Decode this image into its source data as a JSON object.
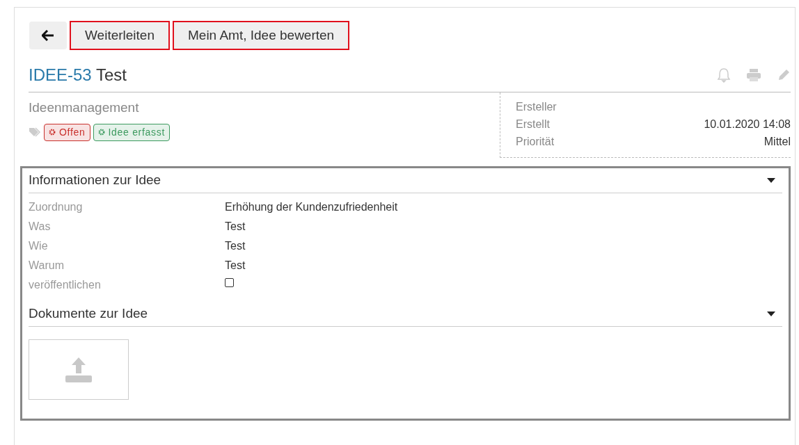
{
  "toolbar": {
    "buttons": [
      {
        "label": "Weiterleiten",
        "highlighted": true
      },
      {
        "label": "Mein Amt, Idee bewerten",
        "highlighted": true
      }
    ]
  },
  "title": {
    "key": "IDEE-53",
    "name": "Test"
  },
  "category": "Ideenmanagement",
  "tags": [
    {
      "label": "Offen",
      "color": "#c9302c"
    },
    {
      "label": "Idee erfasst",
      "color": "#3c9a5f"
    }
  ],
  "meta": [
    {
      "label": "Ersteller"
    },
    {
      "label": "Erstellt",
      "value": "10.01.2020 14:08"
    },
    {
      "label": "Priorität",
      "value": "Mittel"
    }
  ],
  "sections": [
    {
      "kind": "fields",
      "title": "Informationen zur Idee",
      "expanded": true,
      "fields": [
        {
          "kind": "text",
          "label": "Zuordnung",
          "value": "Erhöhung der Kundenzufriedenheit"
        },
        {
          "kind": "text",
          "label": "Was",
          "value": "Test"
        },
        {
          "kind": "text",
          "label": "Wie",
          "value": "Test"
        },
        {
          "kind": "text",
          "label": "Warum",
          "value": "Test"
        },
        {
          "kind": "checkbox",
          "label": "veröffentlichen",
          "checked": false
        }
      ]
    },
    {
      "kind": "upload",
      "title": "Dokumente zur Idee",
      "expanded": true
    }
  ]
}
